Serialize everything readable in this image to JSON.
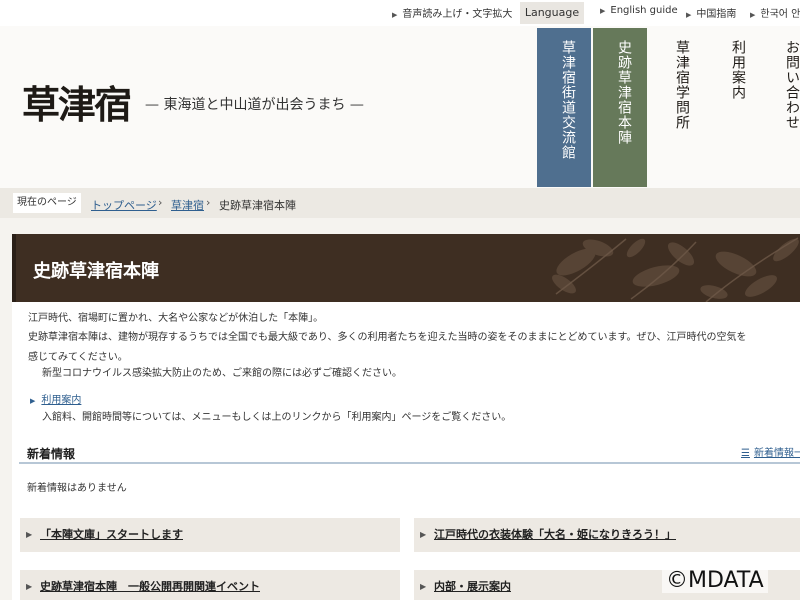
{
  "utility": {
    "read_aloud": "音声読み上げ・文字拡大",
    "language": "Language",
    "english": "English guide",
    "chinese": "中国指南",
    "korean": "한국어 안"
  },
  "header": {
    "logo": "草津宿",
    "tagline": "— 東海道と中山道が出会うまち —",
    "nav": [
      {
        "label": "草津宿街道交流館"
      },
      {
        "label": "史跡草津宿本陣"
      },
      {
        "label": "草津宿学問所"
      },
      {
        "label": "利用案内"
      },
      {
        "label": "お問い合わせ"
      }
    ]
  },
  "breadcrumb": {
    "current_label": "現在のページ",
    "items": [
      "トップページ",
      "草津宿",
      "史跡草津宿本陣"
    ],
    "separator": "›"
  },
  "main": {
    "title": "史跡草津宿本陣",
    "intro": [
      "江戸時代、宿場町に置かれ、大名や公家などが休泊した「本陣」。",
      "史跡草津宿本陣は、建物が現存するうちでは全国でも最大級であり、多くの利用者たちを迎えた当時の姿をそのままにとどめています。ぜひ、江戸時代の空気を",
      "感じてみてください。",
      "新型コロナウイルス感染拡大防止のため、ご来館の際には必ずご確認ください。"
    ],
    "usage_link": "利用案内",
    "usage_desc": "入館料、開館時間等については、メニューもしくは上のリンクから「利用案内」ページをご覧ください。",
    "news": {
      "title": "新着情報",
      "list_link": "新着情報一",
      "empty": "新着情報はありません"
    },
    "cards": [
      {
        "label": "「本陣文庫」スタートします"
      },
      {
        "label": "江戸時代の衣装体験「大名・姫になりきろう！」"
      },
      {
        "label": "史跡草津宿本陣　一般公開再開関連イベント"
      },
      {
        "label": "内部・展示案内"
      }
    ]
  },
  "watermark": "©MDATA",
  "colors": {
    "nav_blue": "#4f6f8f",
    "nav_green": "#66795a",
    "title_bar": "#3e2e22",
    "link": "#2f5f8f"
  }
}
